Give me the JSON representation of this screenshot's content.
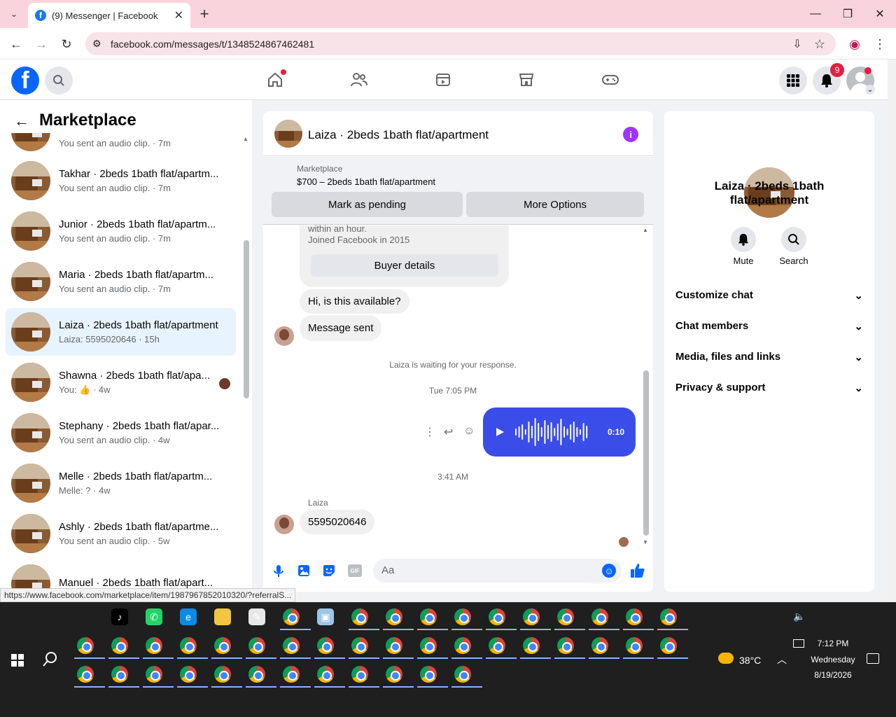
{
  "browser": {
    "tab_title": "(9) Messenger | Facebook",
    "url": "facebook.com/messages/t/1348524867462481",
    "status_url": "https://www.facebook.com/marketplace/item/1987967852010320/?referralS..."
  },
  "fb": {
    "notif_count": "9"
  },
  "sidebar": {
    "title": "Marketplace",
    "first_preview": "You sent an audio clip. · 7m",
    "conversations": [
      {
        "name": "Takhar · 2beds 1bath flat/apartm...",
        "preview": "You sent an audio clip. · 7m"
      },
      {
        "name": "Junior · 2beds 1bath flat/apartm...",
        "preview": "You sent an audio clip. · 7m"
      },
      {
        "name": "Maria · 2beds 1bath flat/apartm...",
        "preview": "You sent an audio clip. · 7m"
      },
      {
        "name": "Laiza · 2beds 1bath flat/apartment",
        "preview": "Laiza: 5595020646 · 15h"
      },
      {
        "name": "Shawna · 2beds 1bath flat/apa...",
        "preview": "You: 👍 · 4w"
      },
      {
        "name": "Stephany · 2beds 1bath flat/apar...",
        "preview": "You sent an audio clip. · 4w"
      },
      {
        "name": "Melle · 2beds 1bath flat/apartm...",
        "preview": "Melle: ? · 4w"
      },
      {
        "name": "Ashly · 2beds 1bath flat/apartme...",
        "preview": "You sent an audio clip. · 5w"
      },
      {
        "name": "Manuel · 2beds 1bath flat/apart...",
        "preview": ""
      }
    ]
  },
  "chat": {
    "title": "Laiza · 2beds 1bath flat/apartment",
    "marketplace_label": "Marketplace",
    "listing": "$700 – 2beds 1bath flat/apartment",
    "mark_pending": "Mark as pending",
    "more_options": "More Options",
    "info_line1": "within an hour.",
    "info_line2": "Joined Facebook in 2015",
    "buyer_details": "Buyer details",
    "msg1": "Hi, is this available?",
    "msg2": "Message sent",
    "waiting": "Laiza is waiting for your response.",
    "time1": "Tue 7:05 PM",
    "audio_duration": "0:10",
    "time2": "3:41 AM",
    "sender": "Laiza",
    "msg3": "5595020646",
    "input_placeholder": "Aa",
    "gif_label": "GIF"
  },
  "right": {
    "title": "Laiza · 2beds 1bath flat/apartment",
    "mute": "Mute",
    "search": "Search",
    "sections": [
      "Customize chat",
      "Chat members",
      "Media, files and links",
      "Privacy & support"
    ]
  },
  "taskbar": {
    "temp": "38°C",
    "time": "7:12 PM",
    "day": "Wednesday",
    "date": "8/19/2026"
  },
  "colors": {
    "accent": "#0866ff",
    "audio_bubble": "#3b4de8",
    "info": "#a033ff"
  }
}
